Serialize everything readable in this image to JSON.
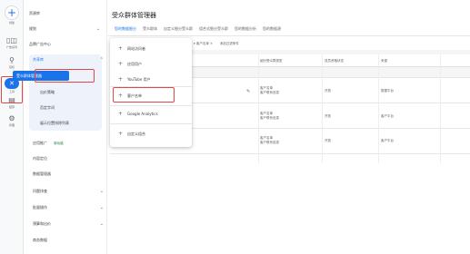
{
  "rail": {
    "create_label": "创建",
    "items": [
      {
        "icon": "chart-icon",
        "glyph": "▯◫",
        "label": "广告系列"
      },
      {
        "icon": "target-icon",
        "glyph": "⚲",
        "label": "目标"
      },
      {
        "icon": "tools-icon",
        "glyph": "✕",
        "label": "工具"
      },
      {
        "icon": "billing-icon",
        "glyph": "▤",
        "label": "结算"
      },
      {
        "icon": "admin-icon",
        "glyph": "⚙",
        "label": "管理"
      }
    ]
  },
  "sidebar": {
    "items": [
      {
        "label": "资源库",
        "chev": ""
      },
      {
        "label": "规划",
        "chev": "⌄"
      },
      {
        "label": "品牌广告中心",
        "chev": ""
      },
      {
        "label": "共享库",
        "chev": "⌃"
      }
    ],
    "sub_active": "受众群体管理器",
    "sub_items": [
      "出价策略",
      "否定字词",
      "展示位置排除列表"
    ],
    "more_items": [
      {
        "label": "应用推广",
        "badge": "新功能",
        "chev": ""
      },
      {
        "label": "内容定位",
        "chev": ""
      },
      {
        "label": "数据管理器",
        "chev": ""
      },
      {
        "label": "问题排查",
        "chev": "⌄"
      },
      {
        "label": "批量操作",
        "chev": "⌄"
      },
      {
        "label": "预算和出价",
        "chev": "⌄"
      },
      {
        "label": "商务数据",
        "chev": ""
      }
    ]
  },
  "main": {
    "title": "受众群体管理器",
    "tabs": [
      "您的数据细分",
      "受众群体",
      "自定义细分受众群",
      "组合式细分受众群",
      "您的数据分析",
      "您的数据源"
    ],
    "filter": [
      "▾ 客户名单 ✕",
      "添加过滤条件"
    ],
    "columns": [
      "细分受众群类型",
      "成员资格状态",
      "来源"
    ],
    "rows": [
      {
        "type": "客户名单\n客户联系信息",
        "status": "开放",
        "source": "数据平台"
      },
      {
        "type": "客户名单\n客户联系信息",
        "status": "开放",
        "source": "客户平台"
      },
      {
        "type": "客户名单\n客户联系信息",
        "status": "开放",
        "source": "客户平台"
      }
    ]
  },
  "menu": {
    "items": [
      "网站访问者",
      "应用用户",
      "YouTube 用户",
      "客户名单",
      "Google Analytics",
      "自定义组合"
    ]
  }
}
